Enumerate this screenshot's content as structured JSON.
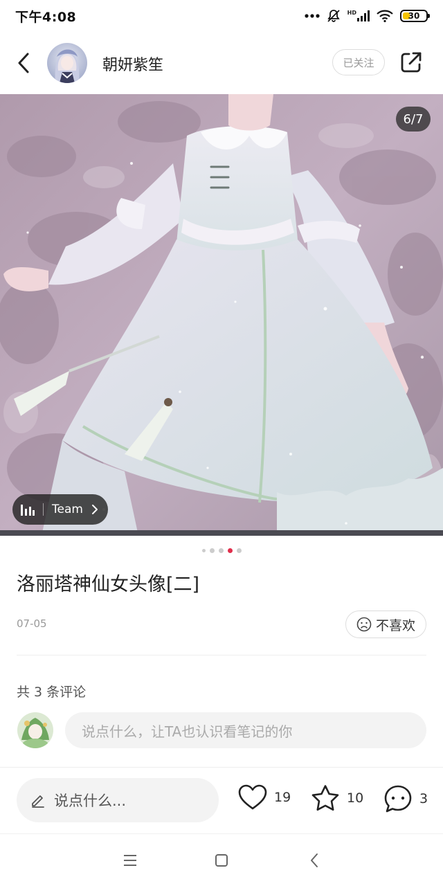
{
  "status_bar": {
    "time": "下午4:08",
    "network_label": "HD",
    "battery_level": "30",
    "battery_color": "#f5c400"
  },
  "header": {
    "back_icon": "chevron-left-icon",
    "author_name": "朝妍紫笙",
    "follow_label": "已关注",
    "share_icon": "share-icon"
  },
  "image": {
    "page_indicator": "6/7",
    "team_label": "Team",
    "current_index": 4,
    "total_dots": 5
  },
  "note": {
    "title": "洛丽塔神仙女头像[二]",
    "date": "07-05",
    "dislike_label": "不喜欢"
  },
  "comments": {
    "count_label": "共 3 条评论",
    "input_placeholder": "说点什么，让TA也认识看笔记的你"
  },
  "bottom_bar": {
    "say_placeholder": "说点什么...",
    "like_count": "19",
    "favorite_count": "10",
    "comment_count": "3"
  },
  "colors": {
    "accent": "#e02e4b",
    "text_primary": "#222222",
    "text_secondary": "#999999"
  }
}
